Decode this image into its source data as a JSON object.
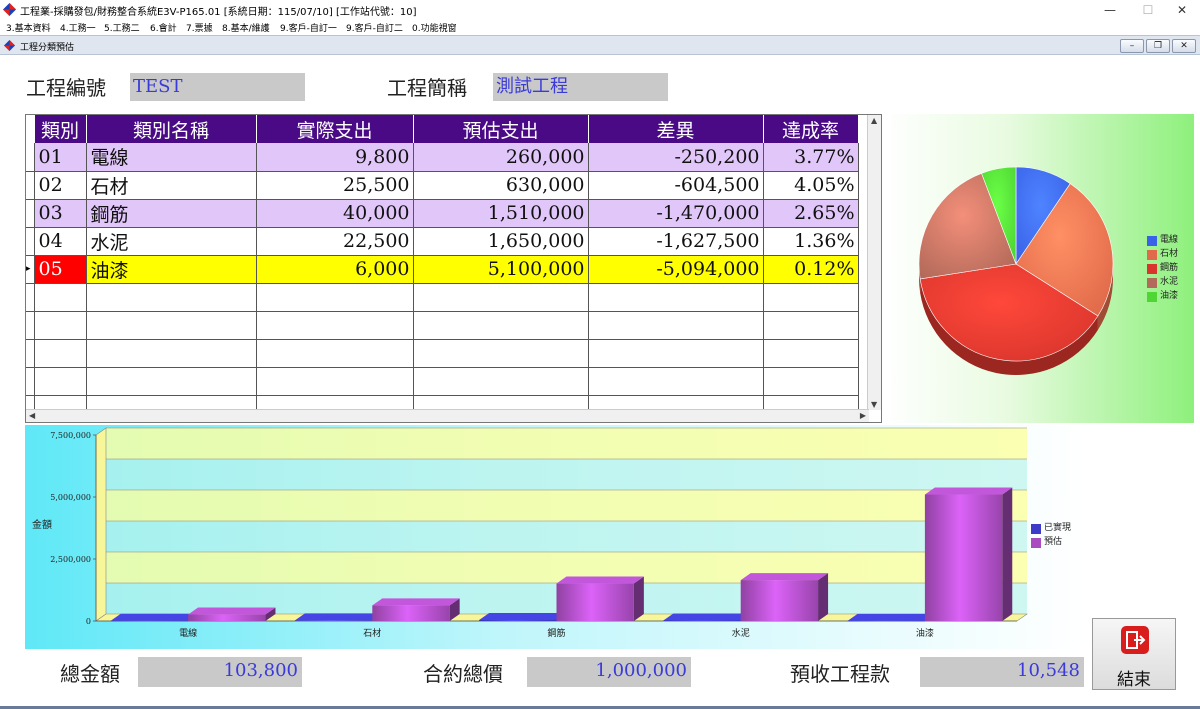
{
  "window": {
    "title": "工程業-採購發包/財務整合系統E3V-P165.01 [系統日期：115/07/10] [工作站代號：10]",
    "minimize": "—",
    "maximize": "☐",
    "close": "✕"
  },
  "menu": [
    "3.基本資料",
    "4.工務一",
    "5.工務二",
    "6.會計",
    "7.票據",
    "8.基本/維護",
    "9.客戶-自訂一",
    "9.客戶-自訂二",
    "0.功能視窗"
  ],
  "child_window": {
    "title": "工程分類預估",
    "minimize": "–",
    "restore": "❐",
    "close": "✕"
  },
  "header": {
    "project_code_label": "工程編號",
    "project_code_value": "TEST",
    "project_name_label": "工程簡稱",
    "project_name_value": "測試工程"
  },
  "grid": {
    "columns": [
      "類別",
      "類別名稱",
      "實際支出",
      "預估支出",
      "差異",
      "達成率"
    ],
    "rows": [
      {
        "code": "01",
        "name": "電線",
        "actual": "9,800",
        "estimate": "260,000",
        "diff": "-250,200",
        "rate": "3.77%"
      },
      {
        "code": "02",
        "name": "石材",
        "actual": "25,500",
        "estimate": "630,000",
        "diff": "-604,500",
        "rate": "4.05%"
      },
      {
        "code": "03",
        "name": "鋼筋",
        "actual": "40,000",
        "estimate": "1,510,000",
        "diff": "-1,470,000",
        "rate": "2.65%"
      },
      {
        "code": "04",
        "name": "水泥",
        "actual": "22,500",
        "estimate": "1,650,000",
        "diff": "-1,627,500",
        "rate": "1.36%"
      },
      {
        "code": "05",
        "name": "油漆",
        "actual": "6,000",
        "estimate": "5,100,000",
        "diff": "-5,094,000",
        "rate": "0.12%"
      }
    ],
    "selected_row": 4,
    "empty_rows": 5
  },
  "chart_data": [
    {
      "type": "pie",
      "categories": [
        "電線",
        "石材",
        "鋼筋",
        "水泥",
        "油漆"
      ],
      "values": [
        9800,
        25500,
        40000,
        22500,
        6000
      ],
      "legend": [
        "電線",
        "石材",
        "鋼筋",
        "水泥",
        "油漆"
      ],
      "colors": [
        "#3a62e8",
        "#e06a4a",
        "#d9352c",
        "#b46a5a",
        "#4fd634"
      ],
      "legend_position": "right"
    },
    {
      "type": "bar",
      "categories": [
        "電線",
        "石材",
        "鋼筋",
        "水泥",
        "油漆"
      ],
      "series": [
        {
          "name": "已實現",
          "values": [
            9800,
            25500,
            40000,
            22500,
            6000
          ],
          "color": "#3c3cc8"
        },
        {
          "name": "預估",
          "values": [
            260000,
            630000,
            1510000,
            1650000,
            5100000
          ],
          "color": "#a94cbf"
        }
      ],
      "ylabel": "金額",
      "ylim": [
        0,
        7500000
      ],
      "yticks": [
        "0",
        "2,500,000",
        "5,000,000",
        "7,500,000"
      ],
      "ytick_values": [
        0,
        2500000,
        5000000,
        7500000
      ],
      "grid": true,
      "legend_position": "right"
    }
  ],
  "footer": {
    "total_label": "總金額",
    "total_value": "103,800",
    "contract_label": "合約總價",
    "contract_value": "1,000,000",
    "prepaid_label": "預收工程款",
    "prepaid_value": "10,548",
    "exit_label": "結束"
  },
  "colors": {
    "grid_header": "#4a0a86",
    "row_alt": "#e1c6fa",
    "row_selected": "#ffff00",
    "cell_selected": "#ff0000",
    "field_bg": "#c9c9c9",
    "field_text": "#3a3ad8"
  }
}
